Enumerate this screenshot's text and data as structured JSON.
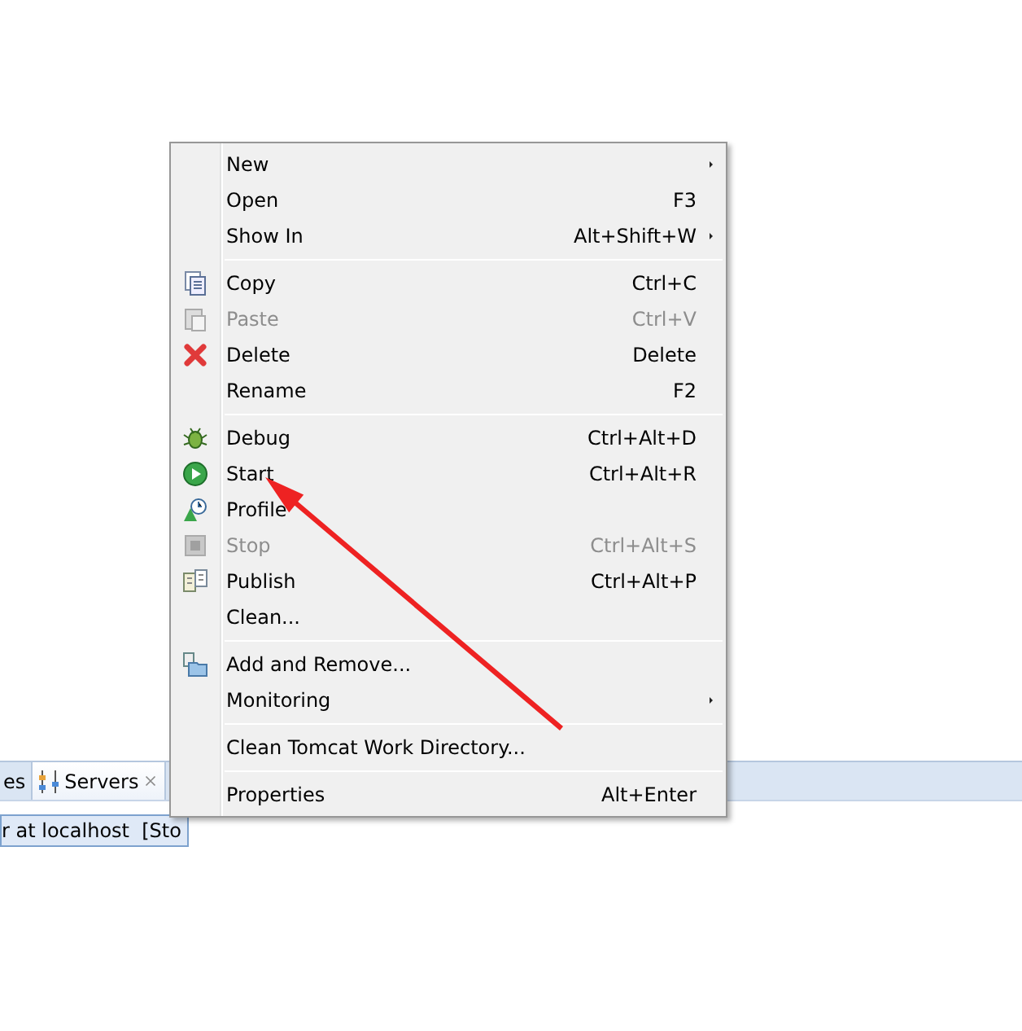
{
  "context_menu": {
    "groups": [
      [
        {
          "label": "New",
          "submenu": true,
          "disabled": false
        },
        {
          "label": "Open",
          "shortcut": "F3",
          "submenu": false,
          "disabled": false
        },
        {
          "label": "Show In",
          "shortcut": "Alt+Shift+W",
          "submenu": true,
          "disabled": false
        }
      ],
      [
        {
          "label": "Copy",
          "shortcut": "Ctrl+C",
          "submenu": false,
          "disabled": false
        },
        {
          "label": "Paste",
          "shortcut": "Ctrl+V",
          "submenu": false,
          "disabled": true
        },
        {
          "label": "Delete",
          "shortcut": "Delete",
          "submenu": false,
          "disabled": false
        },
        {
          "label": "Rename",
          "shortcut": "F2",
          "submenu": false,
          "disabled": false
        }
      ],
      [
        {
          "label": "Debug",
          "shortcut": "Ctrl+Alt+D",
          "submenu": false,
          "disabled": false
        },
        {
          "label": "Start",
          "shortcut": "Ctrl+Alt+R",
          "submenu": false,
          "disabled": false
        },
        {
          "label": "Profile",
          "submenu": false,
          "disabled": false
        },
        {
          "label": "Stop",
          "shortcut": "Ctrl+Alt+S",
          "submenu": false,
          "disabled": true
        },
        {
          "label": "Publish",
          "shortcut": "Ctrl+Alt+P",
          "submenu": false,
          "disabled": false
        },
        {
          "label": "Clean...",
          "submenu": false,
          "disabled": false
        }
      ],
      [
        {
          "label": "Add and Remove...",
          "submenu": false,
          "disabled": false
        },
        {
          "label": "Monitoring",
          "submenu": true,
          "disabled": false
        }
      ],
      [
        {
          "label": "Clean Tomcat Work Directory...",
          "submenu": false,
          "disabled": false
        }
      ],
      [
        {
          "label": "Properties",
          "shortcut": "Alt+Enter",
          "submenu": false,
          "disabled": false
        }
      ]
    ]
  },
  "panel": {
    "tabs": [
      {
        "label": "es",
        "selected": false,
        "closable": false
      },
      {
        "label": "Servers",
        "selected": true,
        "closable": true
      }
    ],
    "rows": [
      {
        "text": "r at localhost  [Sto",
        "selected": true
      }
    ]
  }
}
